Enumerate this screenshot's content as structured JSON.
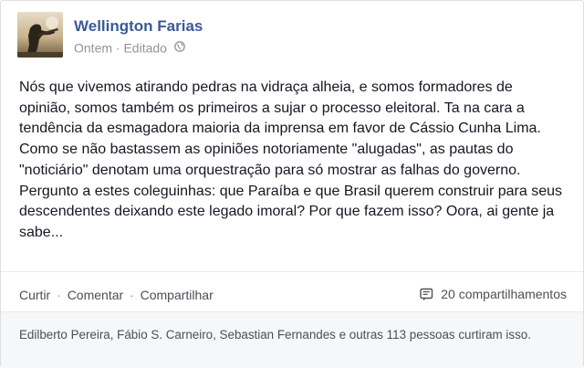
{
  "post": {
    "author": "Wellington Farias",
    "time": "Ontem",
    "separator": "·",
    "edited": "Editado",
    "privacy_icon": "globe-icon",
    "text": "Nós que vivemos atirando pedras na vidraça alheia, e somos formadores de opinião, somos também os primeiros a sujar o processo eleitoral. Ta na cara a tendência da esmagadora maioria da imprensa em favor de Cássio Cunha Lima. Como se não bastassem as opiniões notoriamente \"alugadas\", as pautas do \"noticiário\" denotam uma orquestração para só mostrar as falhas do governo. Pergunto a estes coleguinhas: que Paraíba e que Brasil querem construir para seus descendentes deixando este legado imoral? Por que fazem isso? Oora, ai gente ja sabe..."
  },
  "actions": {
    "like": "Curtir",
    "comment": "Comentar",
    "share": "Compartilhar",
    "separator": "·",
    "shares_count": "20 compartilhamentos",
    "shares_icon": "share-count-icon"
  },
  "likes_summary": "Edilberto Pereira, Fábio S. Carneiro, Sebastian Fernandes e outras 113 pessoas curtiram isso.",
  "colors": {
    "link": "#3b5998",
    "meta": "#90949c",
    "text": "#141823",
    "footer_bg": "#f6f7f9"
  }
}
